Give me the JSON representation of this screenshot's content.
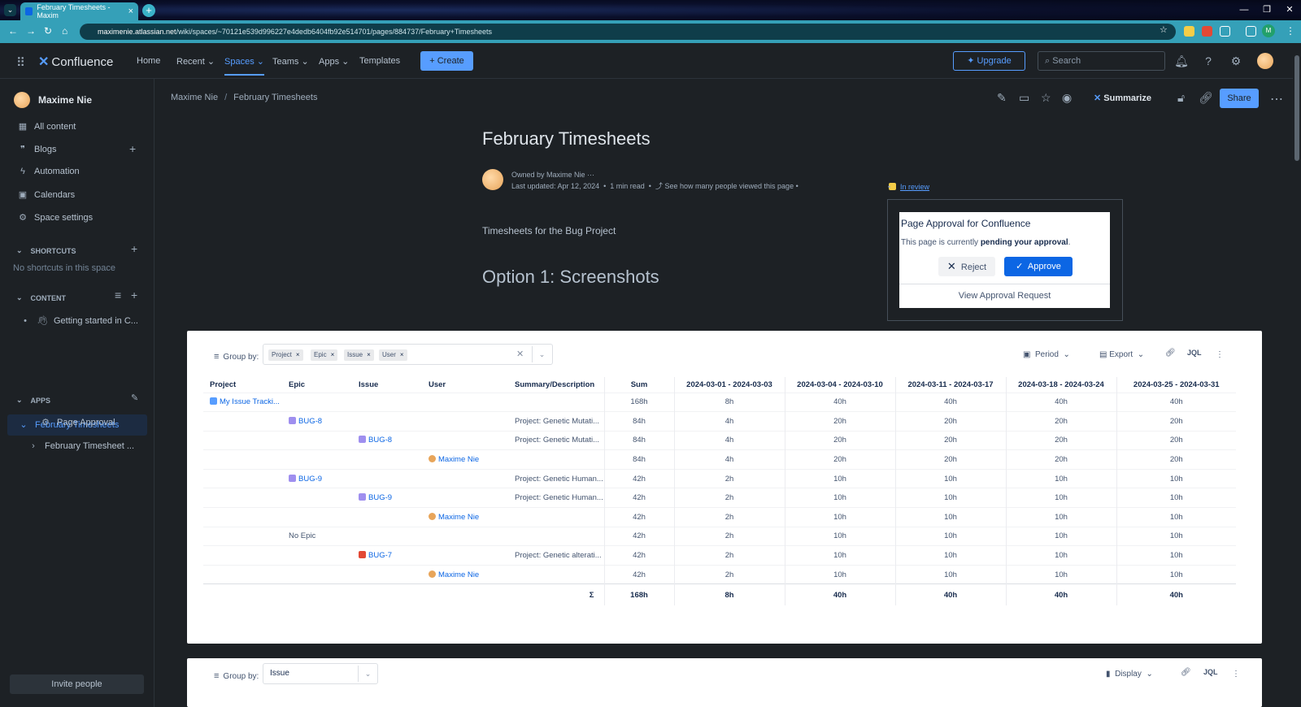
{
  "browser": {
    "tab_title": "February Timesheets - Maxim",
    "url_domain": "maximenie.atlassian.net",
    "url_path": "/wiki/spaces/~70121e539d996227e4dedb6404fb92e514701/pages/884737/February+Timesheets",
    "profile_initial": "M"
  },
  "topnav": {
    "logo": "Confluence",
    "items": [
      "Home",
      "Recent",
      "Spaces",
      "Teams",
      "Apps",
      "Templates"
    ],
    "create": "Create",
    "upgrade": "Upgrade",
    "search_placeholder": "Search"
  },
  "sidebar": {
    "space_name": "Maxime Nie",
    "items": [
      "All content",
      "Blogs",
      "Automation",
      "Calendars",
      "Space settings"
    ],
    "shortcuts_label": "SHORTCUTS",
    "shortcuts_empty": "No shortcuts in this space",
    "content_label": "CONTENT",
    "content_items": [
      "Getting started in C...",
      "February Timesheets",
      "February Timesheet ..."
    ],
    "apps_label": "APPS",
    "apps_items": [
      "Page Approval"
    ],
    "invite": "Invite people"
  },
  "page": {
    "breadcrumb": [
      "Maxime Nie",
      "February Timesheets"
    ],
    "summarize": "Summarize",
    "share": "Share",
    "title": "February Timesheets",
    "owned_by": "Owned by Maxime Nie",
    "last_updated": "Last updated: Apr 12, 2024",
    "read_time": "1 min read",
    "views": "See how many people viewed this page",
    "status": "In review",
    "description": "Timesheets for the Bug Project",
    "heading": "Option 1: Screenshots"
  },
  "approval": {
    "title": "Page Approval for Confluence",
    "text_pre": "This page is currently ",
    "text_bold": "pending your approval",
    "text_post": ".",
    "reject": "Reject",
    "approve": "Approve",
    "view_request": "View Approval Request"
  },
  "timesheet1": {
    "group_by_label": "Group by:",
    "chips": [
      "Project",
      "Epic",
      "Issue",
      "User"
    ],
    "period": "Period",
    "export": "Export",
    "jql": "JQL",
    "columns": [
      "Project",
      "Epic",
      "Issue",
      "User",
      "Summary/Description",
      "Sum",
      "2024-03-01 - 2024-03-03",
      "2024-03-04 - 2024-03-10",
      "2024-03-11 - 2024-03-17",
      "2024-03-18 - 2024-03-24",
      "2024-03-25 - 2024-03-31"
    ],
    "rows": [
      {
        "project": "My Issue Tracki...",
        "epic": "",
        "issue": "",
        "user": "",
        "summary": "",
        "sum": "168h",
        "w": [
          "8h",
          "40h",
          "40h",
          "40h",
          "40h"
        ]
      },
      {
        "project": "",
        "epic": "BUG-8",
        "issue": "",
        "user": "",
        "summary": "Project: Genetic Mutati...",
        "sum": "84h",
        "w": [
          "4h",
          "20h",
          "20h",
          "20h",
          "20h"
        ]
      },
      {
        "project": "",
        "epic": "",
        "issue": "BUG-8",
        "user": "",
        "summary": "Project: Genetic Mutati...",
        "sum": "84h",
        "w": [
          "4h",
          "20h",
          "20h",
          "20h",
          "20h"
        ]
      },
      {
        "project": "",
        "epic": "",
        "issue": "",
        "user": "Maxime Nie",
        "summary": "",
        "sum": "84h",
        "w": [
          "4h",
          "20h",
          "20h",
          "20h",
          "20h"
        ]
      },
      {
        "project": "",
        "epic": "BUG-9",
        "issue": "",
        "user": "",
        "summary": "Project: Genetic Human...",
        "sum": "42h",
        "w": [
          "2h",
          "10h",
          "10h",
          "10h",
          "10h"
        ]
      },
      {
        "project": "",
        "epic": "",
        "issue": "BUG-9",
        "user": "",
        "summary": "Project: Genetic Human...",
        "sum": "42h",
        "w": [
          "2h",
          "10h",
          "10h",
          "10h",
          "10h"
        ]
      },
      {
        "project": "",
        "epic": "",
        "issue": "",
        "user": "Maxime Nie",
        "summary": "",
        "sum": "42h",
        "w": [
          "2h",
          "10h",
          "10h",
          "10h",
          "10h"
        ]
      },
      {
        "project": "",
        "epic": "No Epic",
        "issue": "",
        "user": "",
        "summary": "",
        "sum": "42h",
        "w": [
          "2h",
          "10h",
          "10h",
          "10h",
          "10h"
        ]
      },
      {
        "project": "",
        "epic": "",
        "issue": "BUG-7",
        "user": "",
        "summary": "Project: Genetic alterati...",
        "sum": "42h",
        "w": [
          "2h",
          "10h",
          "10h",
          "10h",
          "10h"
        ]
      },
      {
        "project": "",
        "epic": "",
        "issue": "",
        "user": "Maxime Nie",
        "summary": "",
        "sum": "42h",
        "w": [
          "2h",
          "10h",
          "10h",
          "10h",
          "10h"
        ]
      }
    ],
    "total": {
      "symbol": "Σ",
      "sum": "168h",
      "w": [
        "8h",
        "40h",
        "40h",
        "40h",
        "40h"
      ]
    }
  },
  "timesheet2": {
    "group_by_label": "Group by:",
    "group_value": "Issue",
    "display": "Display",
    "jql": "JQL"
  }
}
